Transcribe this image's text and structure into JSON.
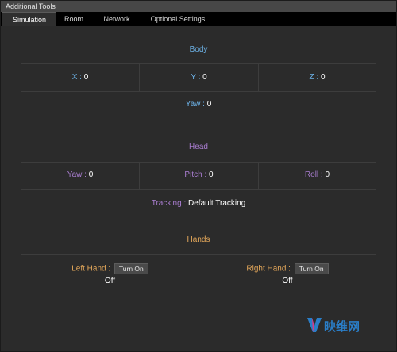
{
  "window": {
    "title": "Additional Tools"
  },
  "tabs": [
    {
      "label": "Simulation",
      "active": true
    },
    {
      "label": "Room",
      "active": false
    },
    {
      "label": "Network",
      "active": false
    },
    {
      "label": "Optional Settings",
      "active": false
    }
  ],
  "body": {
    "heading": "Body",
    "x_label": "X :",
    "x_value": "0",
    "y_label": "Y :",
    "y_value": "0",
    "z_label": "Z :",
    "z_value": "0",
    "yaw_label": "Yaw :",
    "yaw_value": "0"
  },
  "head": {
    "heading": "Head",
    "yaw_label": "Yaw :",
    "yaw_value": "0",
    "pitch_label": "Pitch :",
    "pitch_value": "0",
    "roll_label": "Roll :",
    "roll_value": "0",
    "tracking_label": "Tracking :",
    "tracking_value": "Default Tracking"
  },
  "hands": {
    "heading": "Hands",
    "left_label": "Left Hand :",
    "left_button": "Turn On",
    "left_state": "Off",
    "right_label": "Right Hand :",
    "right_button": "Turn On",
    "right_state": "Off"
  },
  "watermark": {
    "text": "映维网"
  },
  "colors": {
    "body": "#6db3e8",
    "head": "#a97dd0",
    "hands": "#e3a75a"
  }
}
